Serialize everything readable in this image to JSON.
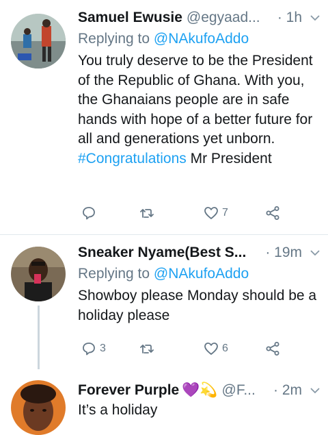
{
  "tweets": [
    {
      "name": "Samuel Ewusie",
      "handle": "@egyaad...",
      "time": "· 1h",
      "replying_prefix": "Replying to",
      "replying_to": "@NAkufoAddo",
      "text_part1": "You truly deserve to be the President of the Republic of Ghana. With you, the Ghanaians people are in safe hands with hope of a better future for all and generations yet unborn. ",
      "hashtag": "#Congratulations",
      "text_part2": " Mr President",
      "reply_count": "",
      "retweet_count": "",
      "like_count": "7"
    },
    {
      "name": "Sneaker Nyame(Best S...",
      "handle": "",
      "time": "· 19m",
      "replying_prefix": "Replying to",
      "replying_to": "@NAkufoAddo",
      "text": "Showboy please Monday should be a holiday please",
      "reply_count": "3",
      "retweet_count": "",
      "like_count": "6"
    },
    {
      "name": "Forever Purple",
      "emoji": "💜💫",
      "handle": "@F...",
      "time": "· 2m",
      "text": "It’s a holiday"
    }
  ],
  "icons": {
    "reply": "reply-icon",
    "retweet": "retweet-icon",
    "like": "heart-icon",
    "share": "share-icon",
    "more": "chevron-down-icon"
  },
  "colors": {
    "text": "#14171a",
    "secondary": "#657786",
    "link": "#1da1f2",
    "divider": "#e1e8ed",
    "thread_line": "#ccd6dd"
  }
}
